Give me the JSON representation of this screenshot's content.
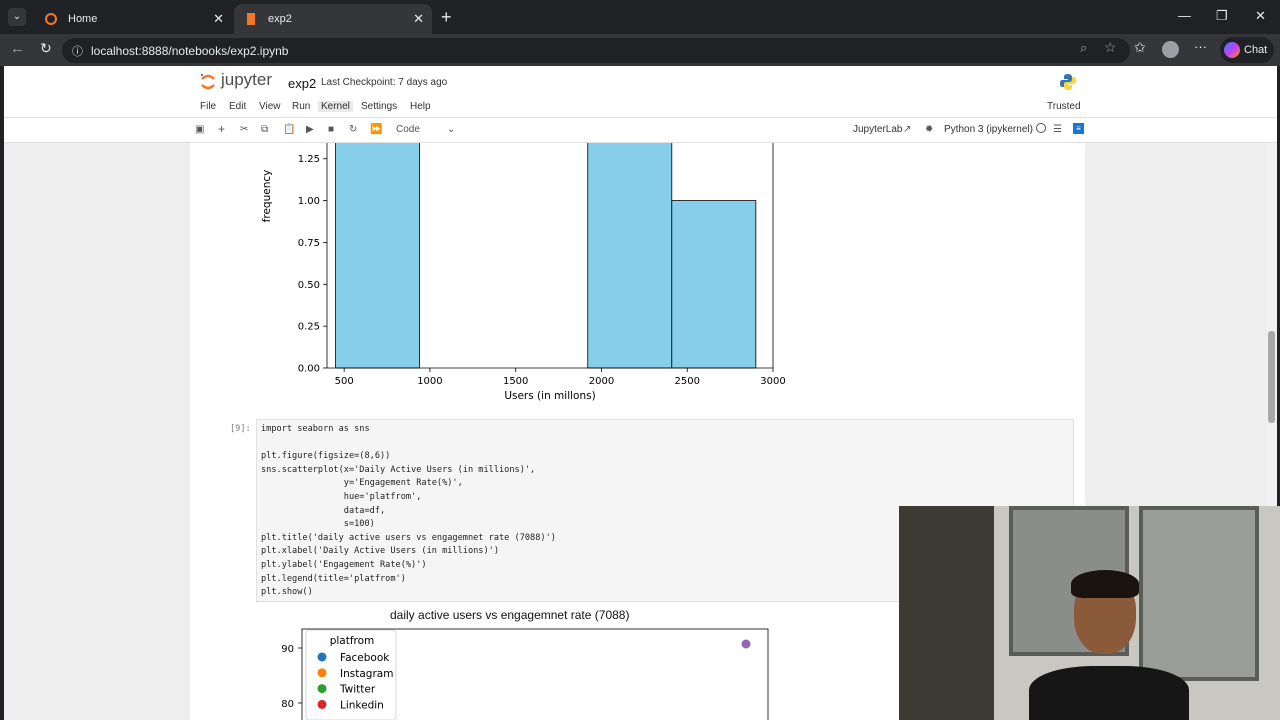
{
  "browser": {
    "tabs": [
      {
        "label": "Home",
        "active": false
      },
      {
        "label": "exp2",
        "active": true
      }
    ],
    "url": "localhost:8888/notebooks/exp2.ipynb",
    "chat_label": "Chat"
  },
  "jupyter": {
    "logo_text": "jupyter",
    "notebook_name": "exp2",
    "checkpoint": "Last Checkpoint: 7 days ago",
    "menus": [
      "File",
      "Edit",
      "View",
      "Run",
      "Kernel",
      "Settings",
      "Help"
    ],
    "trusted": "Trusted",
    "cell_type": "Code",
    "jupyterlab_link": "JupyterLab",
    "kernel_name": "Python 3 (ipykernel)"
  },
  "histogram": {
    "ylabel": "frequency",
    "xlabel": "Users (in millons)",
    "yticks": [
      "1.25",
      "1.00",
      "0.75",
      "0.50",
      "0.25",
      "0.00"
    ],
    "xticks": [
      "500",
      "1000",
      "1500",
      "2000",
      "2500",
      "3000"
    ]
  },
  "cell": {
    "prompt": "[9]:",
    "lines": [
      "import seaborn as sns",
      "",
      "plt.figure(figsize=(8,6))",
      "sns.scatterplot(x='Daily Active Users (in millions)',",
      "                y='Engagement Rate(%)',",
      "                hue='platfrom',",
      "                data=df,",
      "                s=100)",
      "plt.title('daily active users vs engagemnet rate (7088)')",
      "plt.xlabel('Daily Active Users (in millions)')",
      "plt.ylabel('Engagement Rate(%)')",
      "plt.legend(title='platfrom')",
      "plt.show()"
    ]
  },
  "scatter": {
    "title": "daily active users vs engagemnet rate (7088)",
    "yticks": [
      "90",
      "80"
    ],
    "legend_title": "platfrom",
    "legend": [
      {
        "name": "Facebook",
        "color": "#1f77b4"
      },
      {
        "name": "Instagram",
        "color": "#ff7f0e"
      },
      {
        "name": "Twitter",
        "color": "#2ca02c"
      },
      {
        "name": "Linkedin",
        "color": "#d62728"
      }
    ],
    "point_color": "#9467bd"
  },
  "chart_data": [
    {
      "type": "bar",
      "xlabel": "Users (in millons)",
      "ylabel": "frequency",
      "xlim": [
        400,
        3000
      ],
      "bins": [
        {
          "x0": 450,
          "x1": 940,
          "count": 2
        },
        {
          "x0": 940,
          "x1": 1430,
          "count": 0
        },
        {
          "x0": 1430,
          "x1": 1920,
          "count": 0
        },
        {
          "x0": 1920,
          "x1": 2410,
          "count": 2
        },
        {
          "x0": 2410,
          "x1": 2900,
          "count": 1
        }
      ]
    },
    {
      "type": "scatter",
      "title": "daily active users vs engagemnet rate (7088)",
      "series": [
        {
          "color": "#9467bd",
          "points": [
            {
              "y": 90
            }
          ]
        }
      ]
    }
  ]
}
